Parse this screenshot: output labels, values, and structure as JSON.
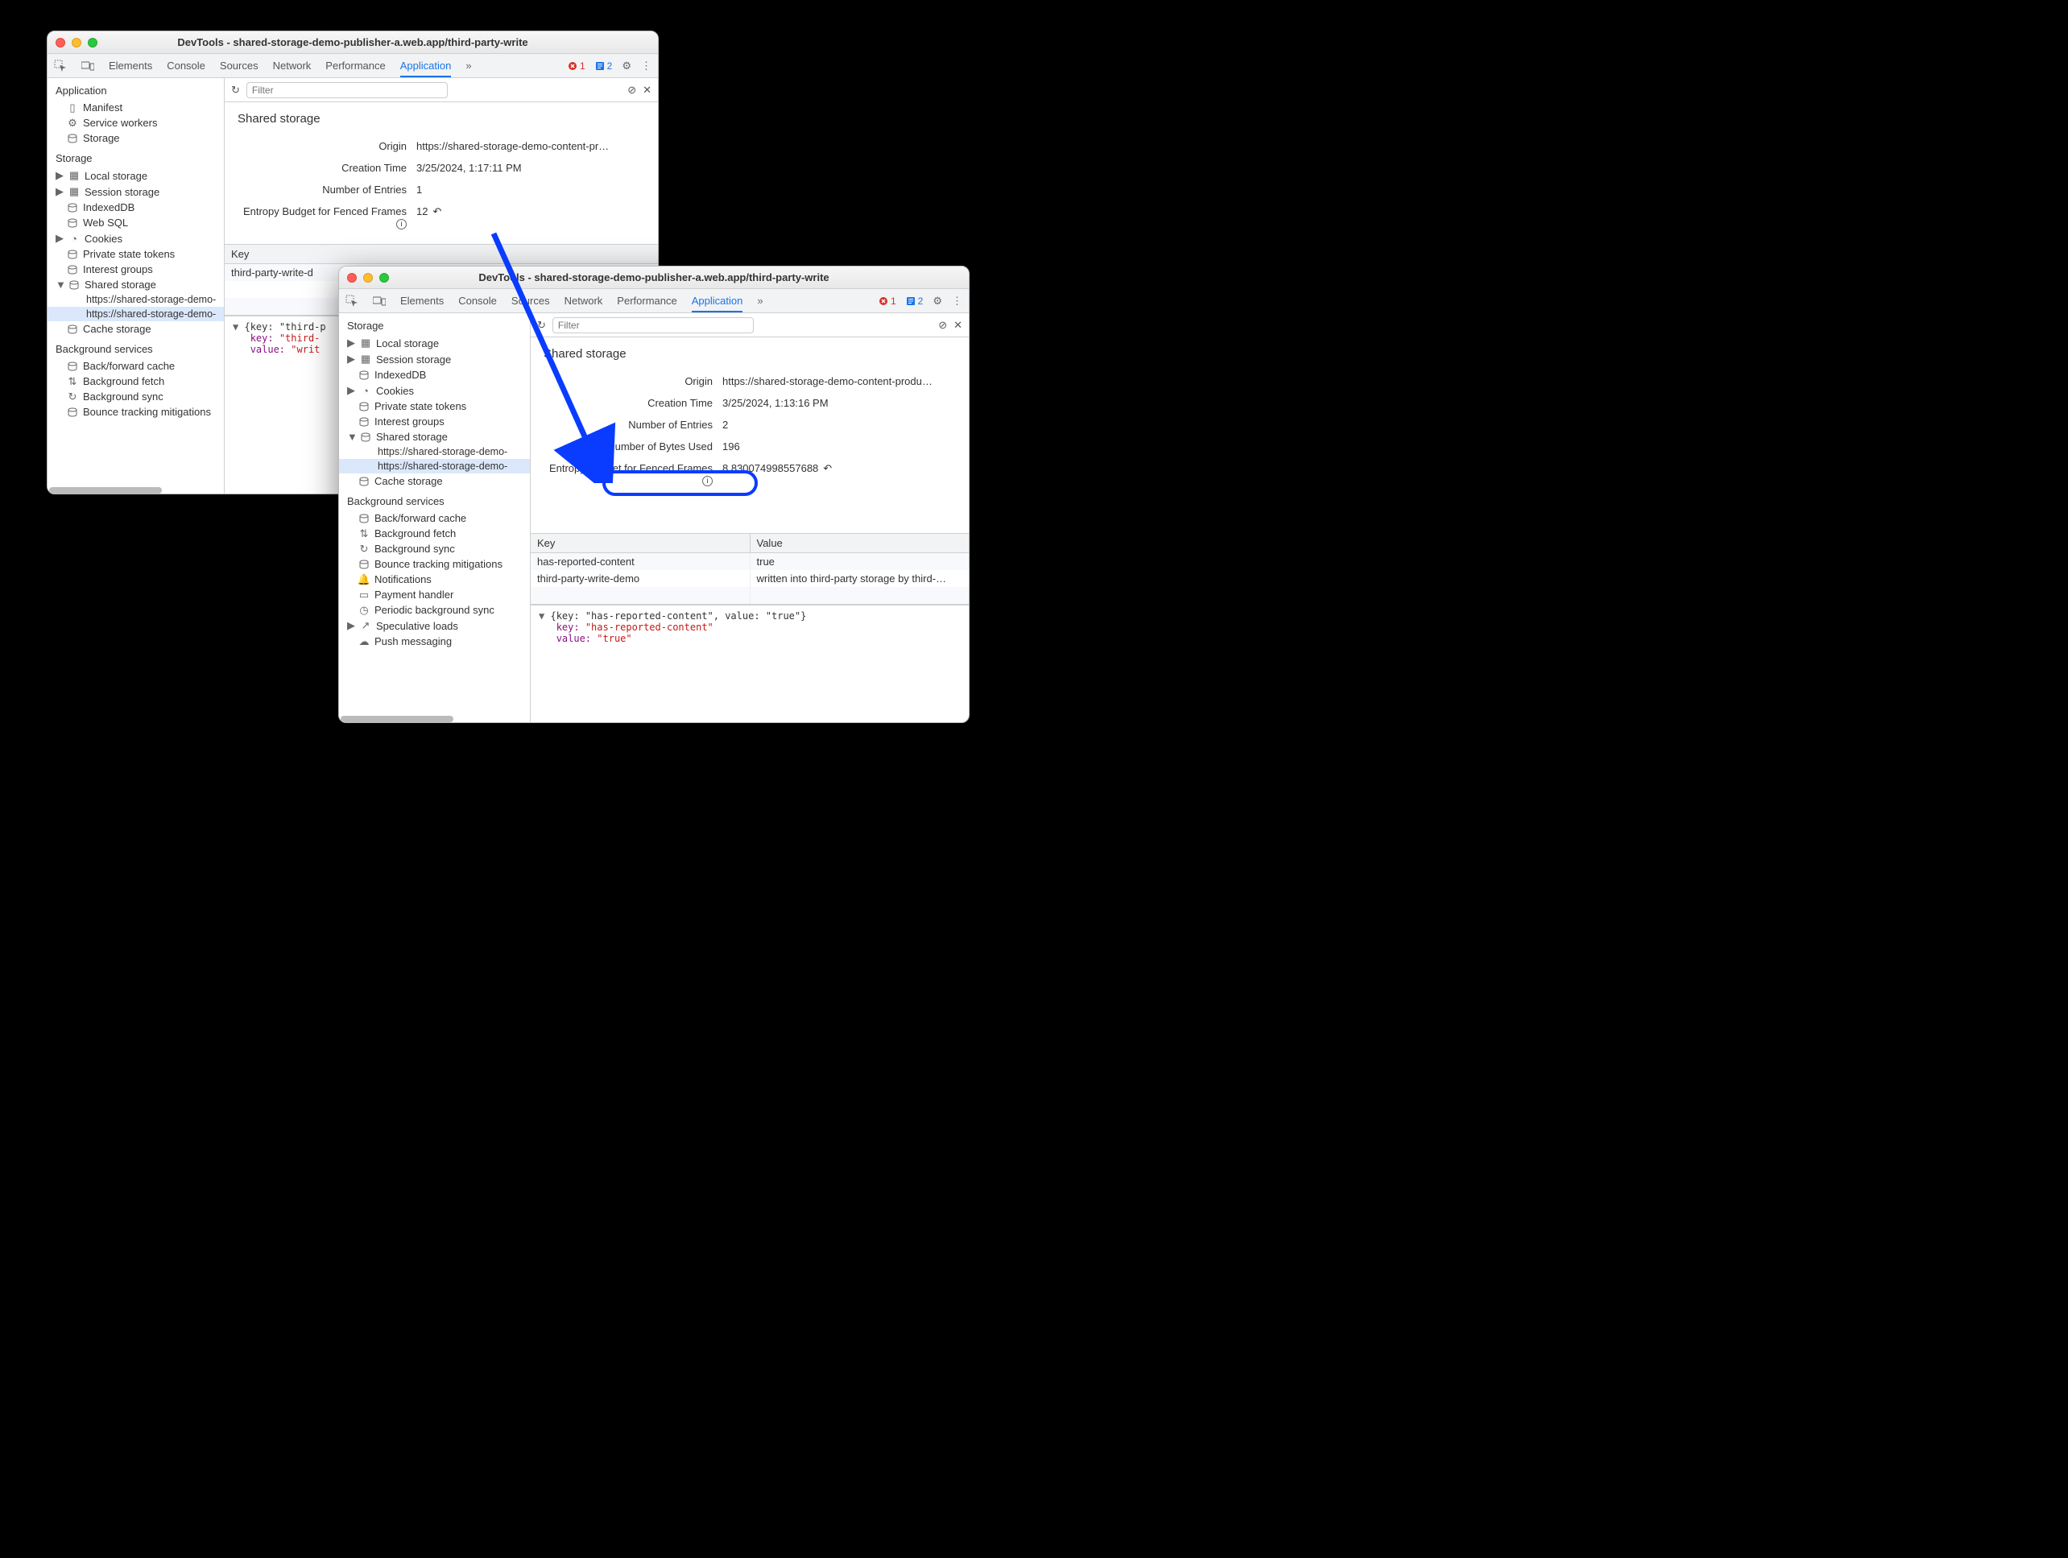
{
  "window1": {
    "title": "DevTools - shared-storage-demo-publisher-a.web.app/third-party-write",
    "tabs": [
      "Elements",
      "Console",
      "Sources",
      "Network",
      "Performance",
      "Application"
    ],
    "active_tab": "Application",
    "error_count": "1",
    "info_count": "2",
    "more_symbol": "»",
    "filter_placeholder": "Filter",
    "sidebar": {
      "app_section": "Application",
      "items_app": [
        {
          "icon": "file",
          "label": "Manifest"
        },
        {
          "icon": "gear",
          "label": "Service workers"
        },
        {
          "icon": "db",
          "label": "Storage"
        }
      ],
      "storage_section": "Storage",
      "items_storage": [
        {
          "tri": "▶",
          "icon": "grid",
          "label": "Local storage"
        },
        {
          "tri": "▶",
          "icon": "grid",
          "label": "Session storage"
        },
        {
          "tri": "",
          "icon": "db",
          "label": "IndexedDB"
        },
        {
          "tri": "",
          "icon": "db",
          "label": "Web SQL"
        },
        {
          "tri": "▶",
          "icon": "cookie",
          "label": "Cookies"
        },
        {
          "tri": "",
          "icon": "db",
          "label": "Private state tokens"
        },
        {
          "tri": "",
          "icon": "db",
          "label": "Interest groups"
        },
        {
          "tri": "▼",
          "icon": "db",
          "label": "Shared storage"
        },
        {
          "sub": true,
          "label": "https://shared-storage-demo-"
        },
        {
          "sub": true,
          "sel": true,
          "label": "https://shared-storage-demo-"
        },
        {
          "tri": "",
          "icon": "db",
          "label": "Cache storage"
        }
      ],
      "bg_section": "Background services",
      "items_bg": [
        {
          "icon": "db",
          "label": "Back/forward cache"
        },
        {
          "icon": "sync",
          "label": "Background fetch"
        },
        {
          "icon": "sync",
          "label": "Background sync"
        },
        {
          "icon": "db",
          "label": "Bounce tracking mitigations"
        }
      ]
    },
    "panel": {
      "heading": "Shared storage",
      "origin_label": "Origin",
      "origin_value": "https://shared-storage-demo-content-pr…",
      "ctime_label": "Creation Time",
      "ctime_value": "3/25/2024, 1:17:11 PM",
      "entries_label": "Number of Entries",
      "entries_value": "1",
      "entropy_label": "Entropy Budget for Fenced Frames",
      "entropy_value": "12"
    },
    "table": {
      "key_header": "Key",
      "rows": [
        {
          "key": "third-party-write-d"
        }
      ]
    },
    "detail": {
      "line1": "{key: \"third-p",
      "key_label": "key:",
      "key_value": "\"third-",
      "value_label": "value:",
      "value_value": "\"writ"
    }
  },
  "window2": {
    "title": "DevTools - shared-storage-demo-publisher-a.web.app/third-party-write",
    "tabs": [
      "Elements",
      "Console",
      "Sources",
      "Network",
      "Performance",
      "Application"
    ],
    "active_tab": "Application",
    "error_count": "1",
    "info_count": "2",
    "more_symbol": "»",
    "filter_placeholder": "Filter",
    "sidebar": {
      "storage_section": "Storage",
      "items_storage": [
        {
          "tri": "▶",
          "icon": "grid",
          "label": "Local storage"
        },
        {
          "tri": "▶",
          "icon": "grid",
          "label": "Session storage"
        },
        {
          "tri": "",
          "icon": "db",
          "label": "IndexedDB"
        },
        {
          "tri": "▶",
          "icon": "cookie",
          "label": "Cookies"
        },
        {
          "tri": "",
          "icon": "db",
          "label": "Private state tokens"
        },
        {
          "tri": "",
          "icon": "db",
          "label": "Interest groups"
        },
        {
          "tri": "▼",
          "icon": "db",
          "label": "Shared storage"
        },
        {
          "sub": true,
          "label": "https://shared-storage-demo-"
        },
        {
          "sub": true,
          "sel": true,
          "label": "https://shared-storage-demo-"
        },
        {
          "tri": "",
          "icon": "db",
          "label": "Cache storage"
        }
      ],
      "bg_section": "Background services",
      "items_bg": [
        {
          "icon": "db",
          "label": "Back/forward cache"
        },
        {
          "icon": "sync",
          "label": "Background fetch"
        },
        {
          "icon": "sync",
          "label": "Background sync"
        },
        {
          "icon": "db",
          "label": "Bounce tracking mitigations"
        },
        {
          "icon": "bell",
          "label": "Notifications"
        },
        {
          "icon": "card",
          "label": "Payment handler"
        },
        {
          "icon": "clock",
          "label": "Periodic background sync"
        },
        {
          "tri": "▶",
          "icon": "arrow",
          "label": "Speculative loads"
        },
        {
          "icon": "cloud",
          "label": "Push messaging"
        }
      ]
    },
    "panel": {
      "heading": "Shared storage",
      "origin_label": "Origin",
      "origin_value": "https://shared-storage-demo-content-produ…",
      "ctime_label": "Creation Time",
      "ctime_value": "3/25/2024, 1:13:16 PM",
      "entries_label": "Number of Entries",
      "entries_value": "2",
      "bytes_label": "Number of Bytes Used",
      "bytes_value": "196",
      "entropy_label": "Entropy Budget for Fenced Frames",
      "entropy_value": "8.830074998557688"
    },
    "table": {
      "key_header": "Key",
      "value_header": "Value",
      "rows": [
        {
          "key": "has-reported-content",
          "value": "true"
        },
        {
          "key": "third-party-write-demo",
          "value": "written into third-party storage by third-…"
        }
      ]
    },
    "detail": {
      "line1": "{key: \"has-reported-content\", value: \"true\"}",
      "key_label": "key:",
      "key_value": "\"has-reported-content\"",
      "value_label": "value:",
      "value_value": "\"true\""
    }
  }
}
